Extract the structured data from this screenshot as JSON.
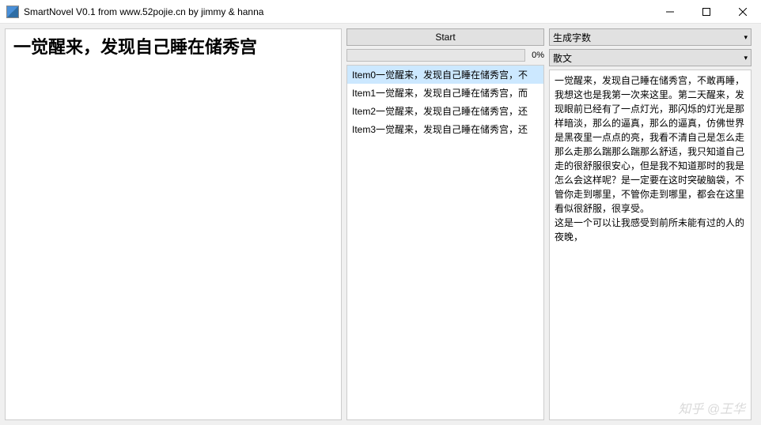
{
  "titlebar": {
    "title": "SmartNovel V0.1  from www.52pojie.cn by jimmy & hanna"
  },
  "input": {
    "text": "一觉醒来，发现自己睡在储秀宫"
  },
  "controls": {
    "start_label": "Start",
    "progress_pct": "0%"
  },
  "items": [
    "Item0一觉醒来，发现自己睡在储秀宫，不",
    "Item1一觉醒来，发现自己睡在储秀宫，而",
    "Item2一觉醒来，发现自己睡在储秀宫，还",
    "Item3一觉醒来，发现自己睡在储秀宫，还"
  ],
  "dropdowns": {
    "word_count": "生成字数",
    "style": "散文"
  },
  "output": {
    "text": "一觉醒来，发现自己睡在储秀宫，不敢再睡，我想这也是我第一次来这里。第二天醒来，发现眼前已经有了一点灯光，那闪烁的灯光是那样暗淡，那么的逼真，那么的逼真，仿佛世界是黑夜里一点点的亮，我看不清自己是怎么走那么走那么踹那么踹那么舒适，我只知道自己走的很舒服很安心，但是我不知道那时的我是怎么会这样呢？是一定要在这时突破脑袋，不管你走到哪里，不管你走到哪里，都会在这里看似很舒服，很享受。\n这是一个可以让我感受到前所未能有过的人的夜晚，"
  },
  "watermark": "知乎 @王华"
}
